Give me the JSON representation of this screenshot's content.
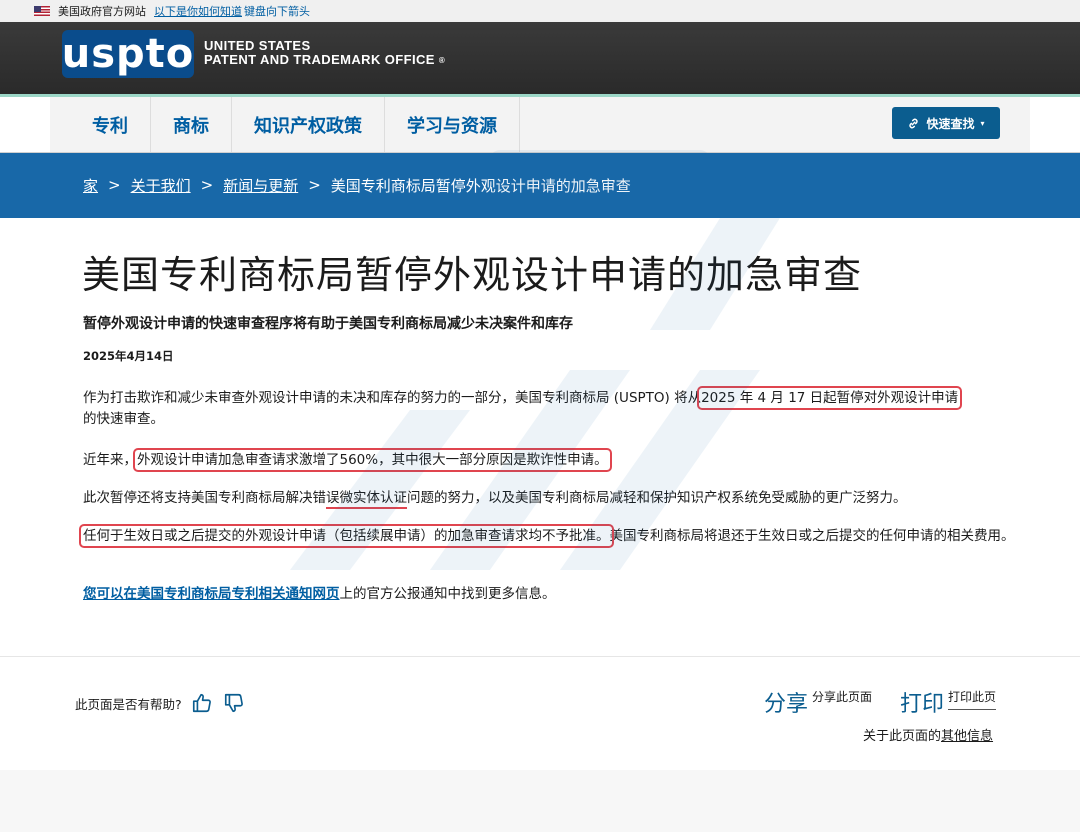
{
  "gov_banner": {
    "text": "美国政府官方网站",
    "link": "以下是你如何知道",
    "link_tail": "键盘向下箭头"
  },
  "masthead": {
    "logo_text": "uspto",
    "agency_line1": "UNITED STATES",
    "agency_line2": "PATENT AND TRADEMARK OFFICE",
    "reg_mark": "®"
  },
  "nav": {
    "items": [
      {
        "label": "专利"
      },
      {
        "label": "商标"
      },
      {
        "label": "知识产权政策"
      },
      {
        "label": "学习与资源"
      }
    ],
    "quick_link_label": "快速查找",
    "quick_link_icon": "link-icon",
    "quick_link_caret": "▾"
  },
  "breadcrumb": {
    "items": [
      "家",
      "关于我们",
      "新闻与更新"
    ],
    "current": "美国专利商标局暂停外观设计申请的加急审查",
    "separator": ">"
  },
  "article": {
    "title": "美国专利商标局暂停外观设计申请的加急审查",
    "subtitle": "暂停外观设计申请的快速审查程序将有助于美国专利商标局减少未决案件和库存",
    "date": "2025年4月14日",
    "p1_a": "作为打击欺诈和减少未审查外观设计申请的未决和库存的努力的一部分，美国专利商标局 (USPTO) 将从",
    "p1_highlight": "2025 年 4 月 17 日起暂停对外观设计申请",
    "p1_b": "的快速审查。",
    "p2_a": "近年来，",
    "p2_highlight": "外观设计申请加急审查请求激增了560%，其中很大一部分原因是欺诈性申请。",
    "p3_a": "此次暂停还将支持美国专利商标局解决错",
    "p3_underline": "误微实体认证",
    "p3_b": "问题的努力，以及美国专利商标局减轻和保护知识产权系统免受威胁的更广泛努力。",
    "p4_highlight": "任何于生效日或之后提交的外观设计申请（包括续展申请）的加急审查请求均不予批准。",
    "p4_b": "美国专利商标局将退还于生效日或之后提交的任何申请的相关费用。",
    "p5_link": "您可以在美国专利商标局专利相关通知网页",
    "p5_b": "上的官方公报通知中找到更多信息。"
  },
  "feedback": {
    "question": "此页面是否有帮助?",
    "thumbs_up": "thumbs-up-icon",
    "thumbs_down": "thumbs-down-icon"
  },
  "actions": {
    "share_big": "分享",
    "share_small": "分享此页面",
    "print_big": "打印",
    "print_small": "打印此页",
    "about_a": "关于此页面的",
    "about_link": "其他信息"
  },
  "colors": {
    "primary": "#005ea2",
    "breadcrumb_bg": "#1868a8",
    "highlight_box": "#e0454f",
    "masthead_bg": "#2f2f2f"
  }
}
